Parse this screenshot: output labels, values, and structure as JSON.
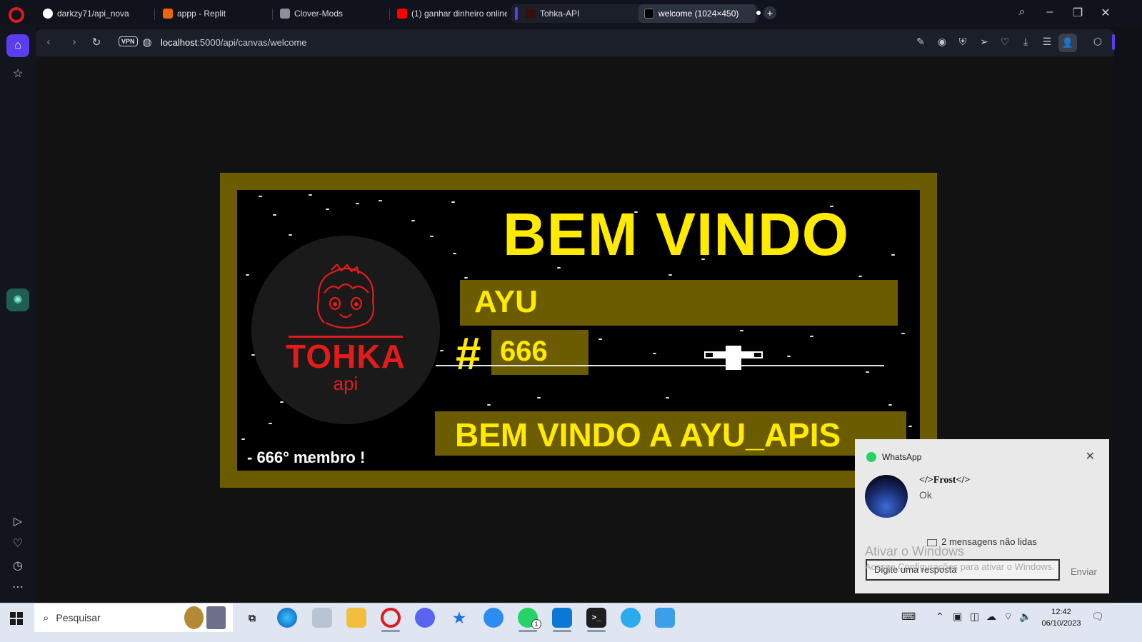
{
  "browser": {
    "tabs": [
      {
        "label": "darkzy71/api_nova",
        "icon": "github-icon"
      },
      {
        "label": "appp - Replit",
        "icon": "replit-icon"
      },
      {
        "label": "Clover-Mods",
        "icon": "clover-icon"
      },
      {
        "label": "(1) ganhar dinheiro online",
        "icon": "youtube-icon"
      },
      {
        "label": "Tohka-API",
        "icon": "tohka-icon"
      },
      {
        "label": "welcome (1024×450)",
        "icon": "canvas-icon",
        "active": true
      }
    ],
    "new_tab": "+",
    "url": {
      "host": "localhost",
      "path": ":5000/api/canvas/welcome"
    },
    "vpn": "VPN"
  },
  "canvas": {
    "title": "BEM VINDO",
    "username": "AYU",
    "hash": "#",
    "discriminator": "666",
    "logo_text": "TOHKA",
    "logo_sub": "api",
    "welcome_banner": "BEM VINDO A AYU_APIS",
    "member_line": "- 666° membro !",
    "colors": {
      "accent": "#ffea00",
      "frame": "#6b5c00",
      "logo": "#e51b1b"
    }
  },
  "notification": {
    "app": "WhatsApp",
    "sender": "</>Frost</>",
    "message": "Ok",
    "unread": "2 mensagens não lidas",
    "reply_placeholder": "Digite uma resposta",
    "send_label": "Enviar",
    "watermark_title": "Ativar o Windows",
    "watermark_sub": "Acesse Configurações para ativar o Windows."
  },
  "taskbar": {
    "search_placeholder": "Pesquisar",
    "whatsapp_badge": "1",
    "time": "12:42",
    "date": "06/10/2023"
  }
}
